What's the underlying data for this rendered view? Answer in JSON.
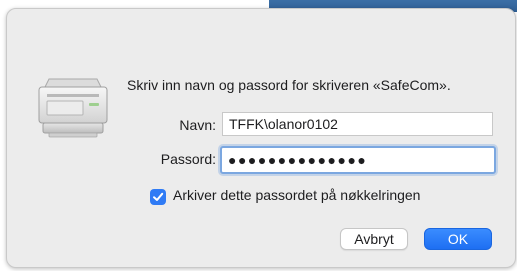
{
  "dialog": {
    "prompt": "Skriv inn navn og passord for skriveren «SafeCom».",
    "name_label": "Navn:",
    "name_value": "TFFK\\olanor0102",
    "password_label": "Passord:",
    "password_value": "●●●●●●●●●●●●●●",
    "remember_label": "Arkiver dette passordet på nøkkelringen",
    "remember_checked": true,
    "cancel_label": "Avbryt",
    "ok_label": "OK"
  },
  "icons": {
    "printer": "printer-icon",
    "checkmark": "checkmark-icon"
  },
  "colors": {
    "accent": "#2f7bf5",
    "dialog_bg": "#ececec",
    "focus_ring": "#7ba7e0"
  }
}
